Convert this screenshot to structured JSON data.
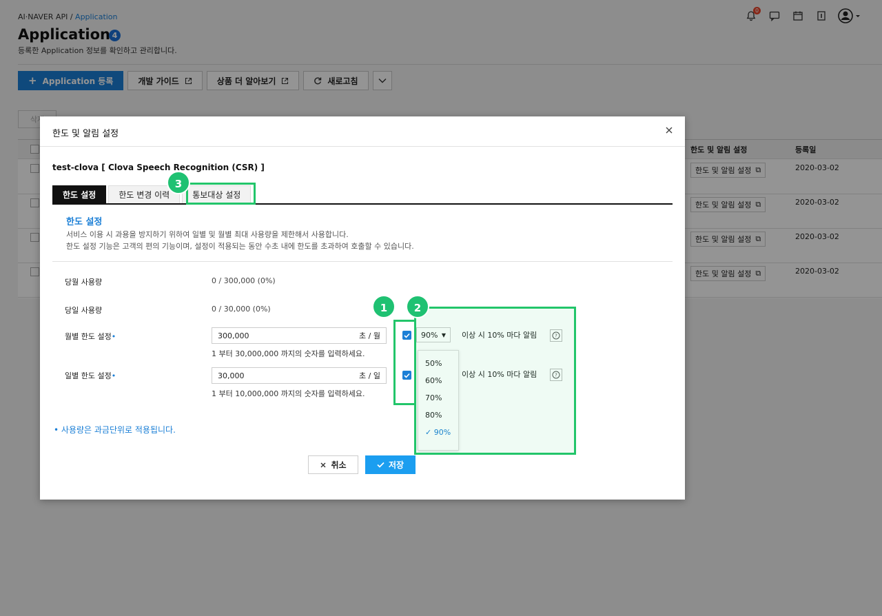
{
  "header": {
    "breadcrumb_root": "AI·NAVER API /",
    "breadcrumb_current": "Application",
    "title": "Application",
    "count": "4",
    "subtitle": "등록한 Application 정보를 확인하고 관리합니다.",
    "notification_count": "0"
  },
  "toolbar": {
    "register": "Application 등록",
    "dev_guide": "개발 가이드",
    "product_info": "상품 더 알아보기",
    "refresh": "새로고침"
  },
  "table": {
    "delete_button": "삭제",
    "headers": {
      "limit": "한도 및 알림 설정",
      "date": "등록일"
    },
    "rows": [
      {
        "action": "한도 및 알림 설정",
        "date": "2020-03-02"
      },
      {
        "action": "한도 및 알림 설정",
        "date": "2020-03-02"
      },
      {
        "action": "한도 및 알림 설정",
        "date": "2020-03-02"
      },
      {
        "action": "한도 및 알림 설정",
        "date": "2020-03-02"
      }
    ]
  },
  "modal": {
    "title": "한도 및 알림 설정",
    "service_name": "test-clova [ Clova Speech Recognition (CSR) ]",
    "tabs": [
      "한도 설정",
      "한도 변경 이력",
      "통보대상 설정"
    ],
    "section_title": "한도 설정",
    "section_desc_1": "서비스 이용 시 과용을 방지하기 위하여 일별 및 월별 최대 사용량을 제한해서 사용합니다.",
    "section_desc_2": "한도 설정 기능은 고객의 편의 기능이며, 설정이 적용되는 동안 수초 내에 한도를 초과하여 호출할 수 있습니다.",
    "monthly_usage_label": "당월 사용량",
    "monthly_usage_value": "0 / 300,000 (0%)",
    "daily_usage_label": "당일 사용량",
    "daily_usage_value": "0 / 30,000 (0%)",
    "monthly_limit_label": "월별 한도 설정",
    "monthly_limit_value": "300,000",
    "monthly_limit_unit": "초 / 월",
    "monthly_limit_hint": "1 부터 30,000,000 까지의 숫자를 입력하세요.",
    "daily_limit_label": "일별 한도 설정",
    "daily_limit_value": "30,000",
    "daily_limit_unit": "초 / 일",
    "daily_limit_hint": "1 부터 10,000,000 까지의 숫자를 입력하세요.",
    "threshold_selected": "90%",
    "alert_text": "이상 시 10% 마다 알림",
    "threshold_options": [
      "50%",
      "60%",
      "70%",
      "80%",
      "90%"
    ],
    "footnote": "사용량은 과금단위로 적용됩니다.",
    "cancel": "취소",
    "save": "저장"
  },
  "markers": [
    "1",
    "2",
    "3"
  ],
  "colors": {
    "accent": "#1b7fd6",
    "highlight": "#22c56a",
    "save": "#1b9ef0"
  }
}
